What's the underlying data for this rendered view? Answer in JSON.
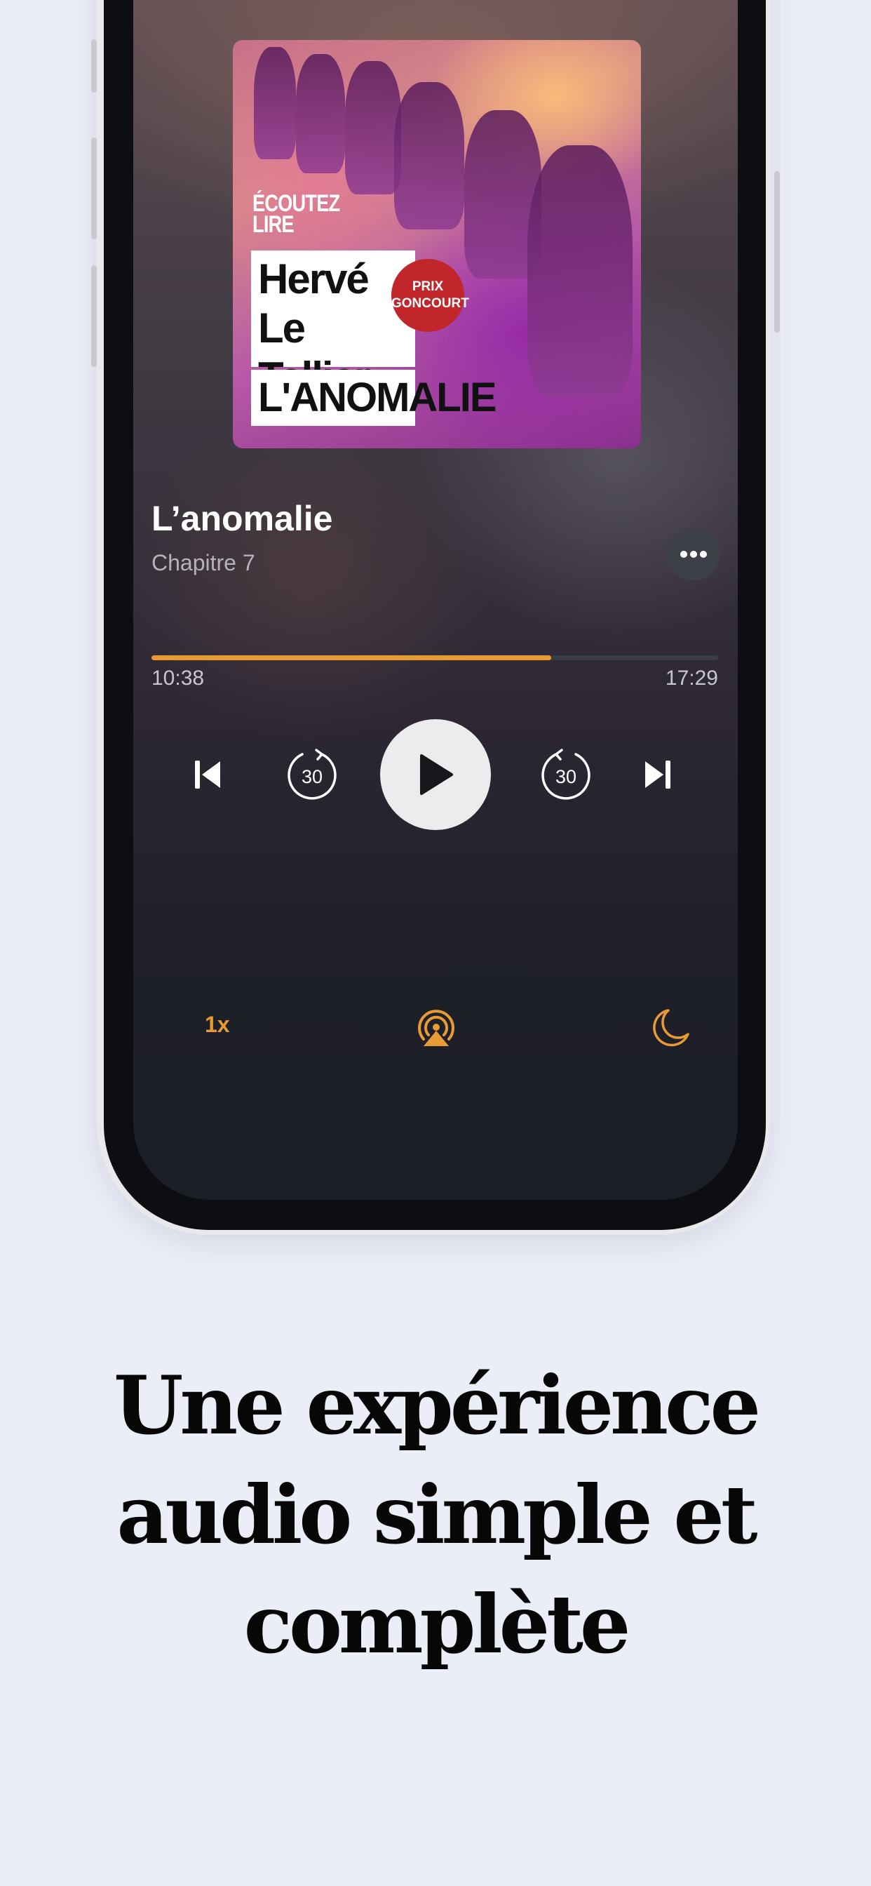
{
  "player": {
    "cover": {
      "publisher_stamp": "ÉCOUTEZ LIRE",
      "author": "Hervé Le Tellier",
      "title": "L'ANOMALIE",
      "award_badge": "PRIX GONCOURT"
    },
    "title": "L’anomalie",
    "chapter": "Chapitre 7",
    "more_icon": "ellipsis-icon",
    "progress": {
      "fraction": 0.705,
      "elapsed": "10:38",
      "remaining": "17:29",
      "color": "#e89a34"
    },
    "controls": {
      "previous_icon": "skip-back-icon",
      "rewind_icon": "rewind-30-icon",
      "rewind_seconds": "30",
      "play_icon": "play-icon",
      "forward_icon": "forward-30-icon",
      "forward_seconds": "30",
      "next_icon": "skip-forward-icon"
    },
    "bottom_bar": {
      "speed": "1x",
      "airplay_icon": "airplay-icon",
      "sleep_timer_icon": "moon-icon",
      "accent_color": "#e89a34"
    }
  },
  "headline": "Une expérience audio simple et complète"
}
